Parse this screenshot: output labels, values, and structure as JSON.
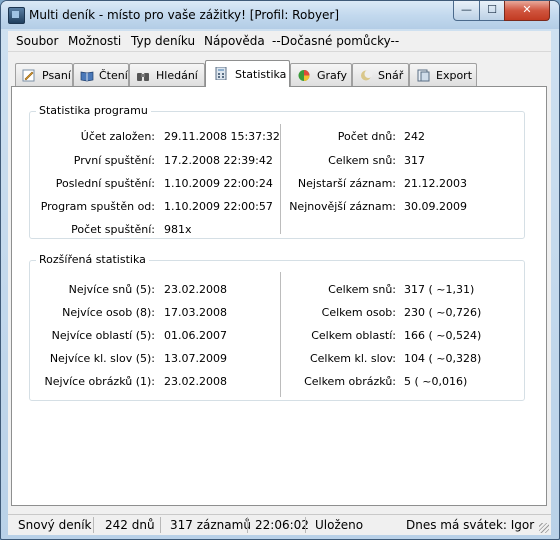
{
  "window": {
    "title": "Multi deník - místo pro vaše zážitky! [Profil: Robyer]",
    "controls": {
      "minimize": "—",
      "maximize": "☐",
      "close": "✕"
    }
  },
  "menu": [
    "Soubor",
    "Možnosti",
    "Typ deníku",
    "Nápověda",
    "--Dočasné pomůcky--"
  ],
  "tabs": [
    {
      "label": "Psaní",
      "icon": "pencil-icon"
    },
    {
      "label": "Čtení",
      "icon": "book-icon"
    },
    {
      "label": "Hledání",
      "icon": "binoculars-icon"
    },
    {
      "label": "Statistika",
      "icon": "calculator-icon",
      "active": true
    },
    {
      "label": "Grafy",
      "icon": "pie-chart-icon"
    },
    {
      "label": "Snář",
      "icon": "moon-icon"
    },
    {
      "label": "Export",
      "icon": "export-icon"
    }
  ],
  "stats_program": {
    "title": "Statistika programu",
    "left": [
      {
        "label": "Účet založen:",
        "value": "29.11.2008 15:37:32"
      },
      {
        "label": "První spuštění:",
        "value": "17.2.2008 22:39:42"
      },
      {
        "label": "Poslední spuštění:",
        "value": "1.10.2009 22:00:24"
      },
      {
        "label": "Program spuštěn od:",
        "value": "1.10.2009 22:00:57"
      },
      {
        "label": "Počet spuštění:",
        "value": "981x"
      }
    ],
    "right": [
      {
        "label": "Počet dnů:",
        "value": "242"
      },
      {
        "label": "Celkem snů:",
        "value": "317"
      },
      {
        "label": "Nejstarší záznam:",
        "value": "21.12.2003"
      },
      {
        "label": "Nejnovější záznam:",
        "value": "30.09.2009"
      }
    ]
  },
  "stats_extended": {
    "title": "Rozšířená statistika",
    "left": [
      {
        "label": "Nejvíce snů (5):",
        "value": "23.02.2008"
      },
      {
        "label": "Nejvíce osob (8):",
        "value": "17.03.2008"
      },
      {
        "label": "Nejvíce oblastí (5):",
        "value": "01.06.2007"
      },
      {
        "label": "Nejvíce kl. slov (5):",
        "value": "13.07.2009"
      },
      {
        "label": "Nejvíce obrázků (1):",
        "value": "23.02.2008"
      }
    ],
    "right": [
      {
        "label": "Celkem snů:",
        "value": "317 ( ~1,31)"
      },
      {
        "label": "Celkem osob:",
        "value": "230 ( ~0,726)"
      },
      {
        "label": "Celkem oblastí:",
        "value": "166 ( ~0,524)"
      },
      {
        "label": "Celkem kl. slov:",
        "value": "104 ( ~0,328)"
      },
      {
        "label": "Celkem obrázků:",
        "value": "5 ( ~0,016)"
      }
    ]
  },
  "statusbar": {
    "diary_type": "Snový deník",
    "days": "242 dnů",
    "records": "317 záznamů",
    "time": "22:06:02",
    "state": "Uloženo",
    "nameday": "Dnes má svátek: Igor"
  }
}
